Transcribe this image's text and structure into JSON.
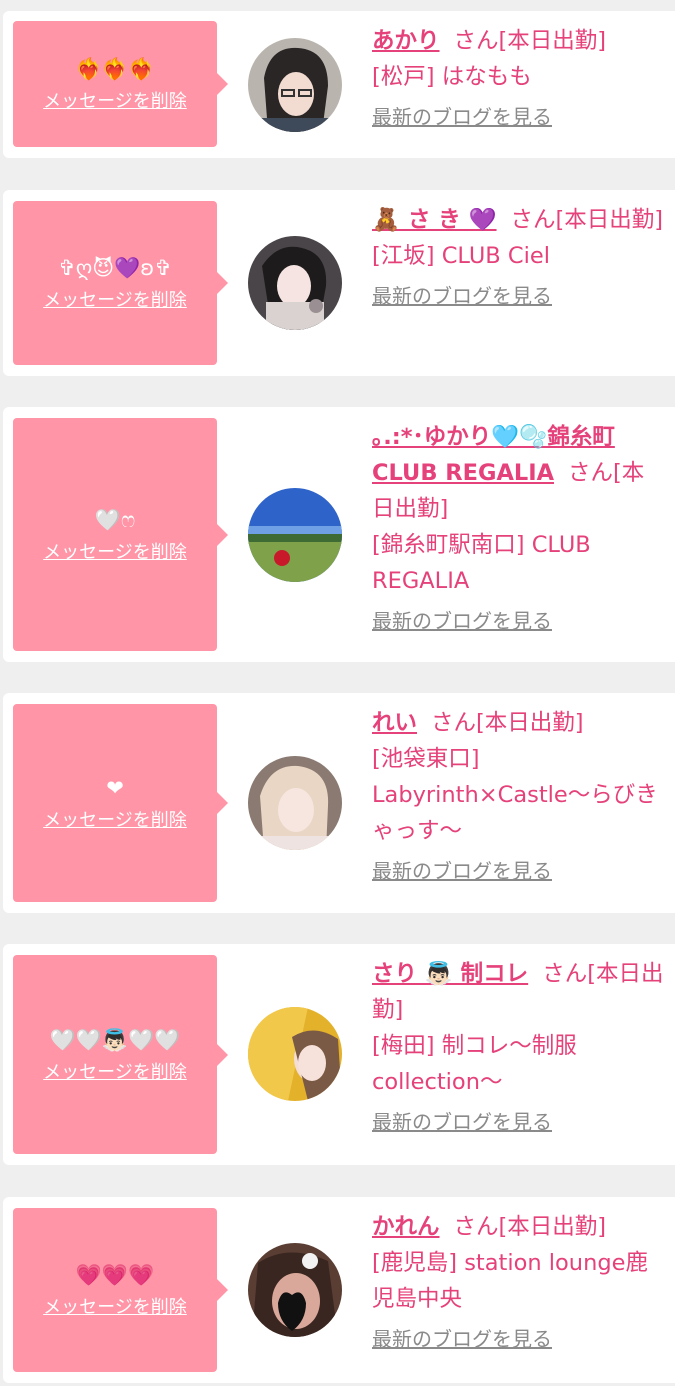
{
  "delete_label": "メッセージを削除",
  "blog_label": "最新のブログを見る",
  "colors": {
    "accent": "#e5417a",
    "bubble": "#ff95a6",
    "muted": "#8a8a8a"
  },
  "items": [
    {
      "message": "❤️‍🔥❤️‍🔥❤️‍🔥",
      "name": "あかり",
      "status": "さん[本日出勤]",
      "shop": "[松戸] はなもも"
    },
    {
      "message": "✞ღ😈💜ʚ✞",
      "name": "🧸 さ き 💜",
      "status": "さん[本日出勤]",
      "shop": "[江坂] CLUB Ciel"
    },
    {
      "message": "🤍ෆ",
      "name": "｡.:*･ゆかり🩵🫧錦糸町CLUB REGALIA",
      "status": "さん[本日出勤]",
      "shop": "[錦糸町駅南口] CLUB REGALIA"
    },
    {
      "message": "❤",
      "name": "れい",
      "status": "さん[本日出勤]",
      "shop": "[池袋東口] Labyrinth×Castle〜らびきゃっす〜"
    },
    {
      "message": "🤍🤍👼🏻🤍🤍",
      "name": "さり 👼🏻 制コレ",
      "status": "さん[本日出勤]",
      "shop": "[梅田] 制コレ〜制服collection〜"
    },
    {
      "message": "💗💗💗",
      "name": "かれん",
      "status": "さん[本日出勤]",
      "shop": "[鹿児島] station lounge鹿児島中央"
    }
  ]
}
